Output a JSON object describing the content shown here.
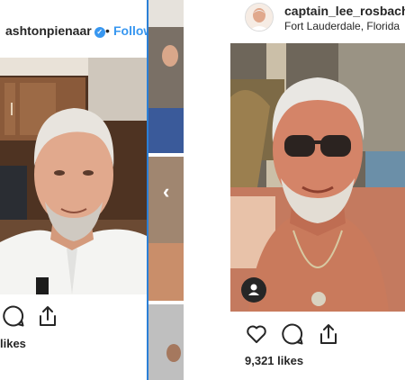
{
  "left_post": {
    "username": "ashtonpienaar",
    "separator": "•",
    "follow_label": "Follow",
    "likes_text": "likes"
  },
  "right_post": {
    "username": "captain_lee_rosbach",
    "location": "Fort Lauderdale, Florida",
    "likes_text": "9,321 likes"
  },
  "colors": {
    "link_blue": "#3897f0",
    "text_dark": "#262626",
    "divider_blue": "#2b7fd6"
  },
  "icons": {
    "verified": "verified-badge-icon",
    "like": "heart-icon",
    "comment": "comment-icon",
    "share": "share-icon",
    "tag": "user-tag-icon",
    "carousel": "chevron-left-icon"
  }
}
